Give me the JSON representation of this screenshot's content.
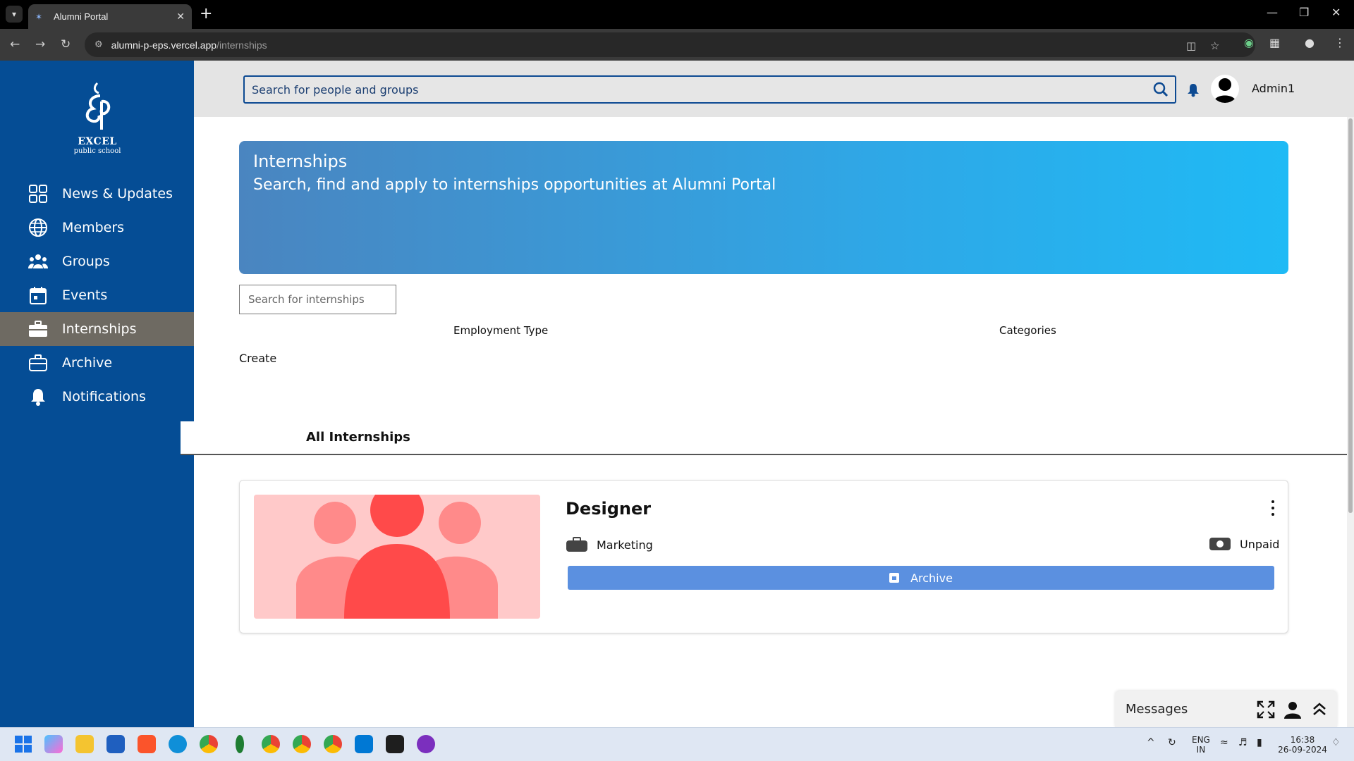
{
  "browser": {
    "tab_title": "Alumni Portal",
    "url_host": "alumni-p-eps.vercel.app",
    "url_path": "/internships"
  },
  "sidebar": {
    "logo_line1": "EXCEL",
    "logo_line2": "public school",
    "items": [
      {
        "label": "News & Updates",
        "icon": "dashboard-grid-icon"
      },
      {
        "label": "Members",
        "icon": "globe-icon"
      },
      {
        "label": "Groups",
        "icon": "people-group-icon"
      },
      {
        "label": "Events",
        "icon": "calendar-icon"
      },
      {
        "label": "Internships",
        "icon": "briefcase-icon",
        "active": true
      },
      {
        "label": "Archive",
        "icon": "archive-box-icon"
      },
      {
        "label": "Notifications",
        "icon": "bell-icon"
      }
    ]
  },
  "header": {
    "search_placeholder": "Search for people and groups",
    "username": "Admin1"
  },
  "hero": {
    "title": "Internships",
    "subtitle": "Search, find and apply to internships opportunities at Alumni Portal"
  },
  "filters": {
    "search_placeholder": "Search for internships",
    "employment_type_label": "Employment Type",
    "categories_label": "Categories",
    "create_label": "Create"
  },
  "tabs": {
    "all_label": "All Internships"
  },
  "internships": [
    {
      "title": "Designer",
      "category": "Marketing",
      "pay": "Unpaid",
      "action_label": "Archive"
    }
  ],
  "messages": {
    "title": "Messages"
  },
  "system": {
    "lang1": "ENG",
    "lang2": "IN",
    "time": "16:38",
    "date": "26-09-2024"
  },
  "colors": {
    "sidebar": "#054d95",
    "active_nav": "#6e6a62",
    "hero_start": "#4a85c0",
    "hero_end": "#1fbaf5",
    "archive_button": "#5b90e0"
  }
}
